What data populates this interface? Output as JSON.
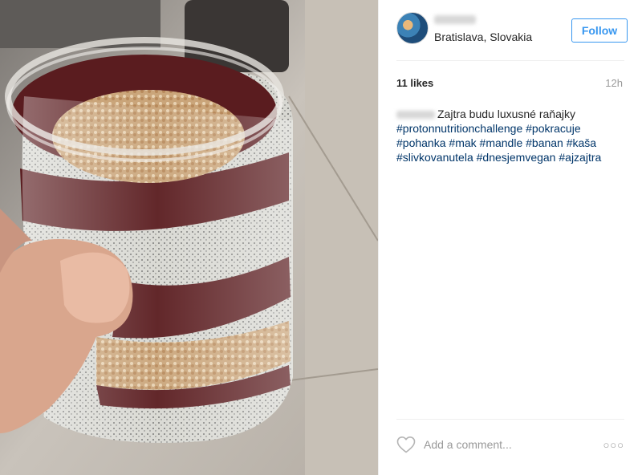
{
  "post": {
    "photo_alt": "jar with layered breakfast",
    "location": "Bratislava, Slovakia",
    "follow_label": "Follow",
    "likes": "11 likes",
    "time_ago": "12h",
    "caption_text": "Zajtra budu luxusné raňajky",
    "hashtags": [
      "#protonnutritionchallenge",
      "#pokracuje",
      "#pohanka",
      "#mak",
      "#mandle",
      "#banan",
      "#kaša",
      "#slivkovanutela",
      "#dnesjemvegan",
      "#ajzajtra"
    ],
    "comment_placeholder": "Add a comment...",
    "more_label": "○○○"
  },
  "colors": {
    "accent": "#3897f0",
    "hashtag": "#003569",
    "muted": "#999999",
    "text": "#262626"
  },
  "icons": {
    "like": "heart-outline-icon",
    "more": "ellipsis-icon"
  }
}
